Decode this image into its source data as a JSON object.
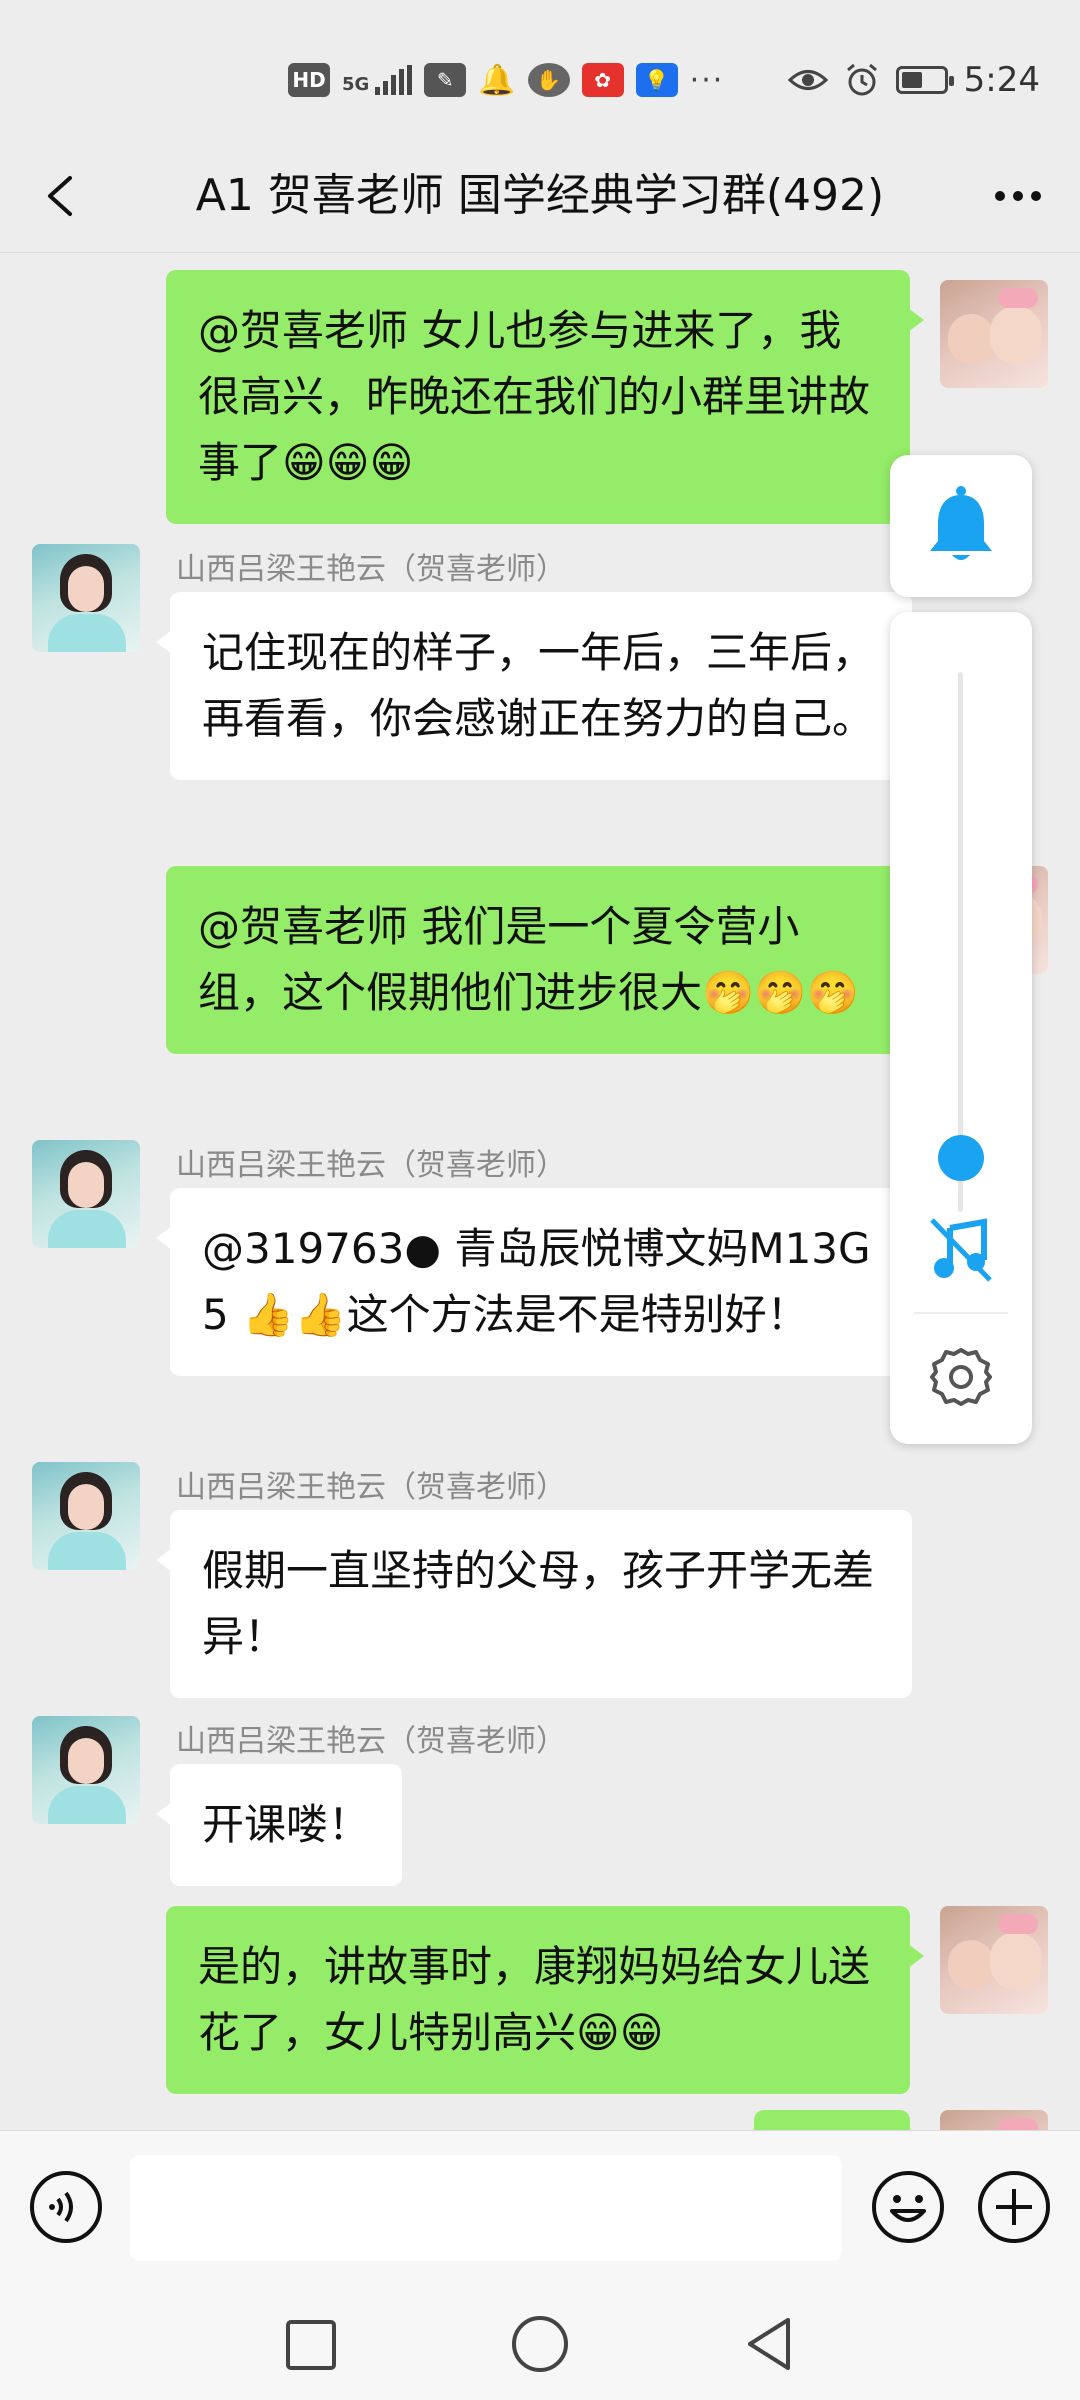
{
  "status_bar": {
    "network_icons": [
      "HD",
      "5G"
    ],
    "time": "5:24"
  },
  "header": {
    "title": "A1 贺喜老师 国学经典学习群(492)"
  },
  "messages": [
    {
      "side": "right",
      "color": "green",
      "text": "@贺喜老师  女儿也参与进来了，我很高兴，昨晚还在我们的小群里讲故事了😁😁😁"
    },
    {
      "side": "left",
      "sender": "山西吕梁王艳云（贺喜老师）",
      "text": "记住现在的样子，一年后，三年后，再看看，你会感谢正在努力的自己。"
    },
    {
      "side": "right",
      "color": "green",
      "text": "@贺喜老师  我们是一个夏令营小组，这个假期他们进步很大🤭🤭🤭"
    },
    {
      "side": "left",
      "sender": "山西吕梁王艳云（贺喜老师）",
      "text": "@319763● 青岛辰悦博文妈M13G5 👍👍这个方法是不是特别好！"
    },
    {
      "side": "left",
      "sender": "山西吕梁王艳云（贺喜老师）",
      "text": "假期一直坚持的父母，孩子开学无差异！"
    },
    {
      "side": "left",
      "sender": "山西吕梁王艳云（贺喜老师）",
      "text": "开课喽！"
    },
    {
      "side": "right",
      "color": "green",
      "text": "是的，讲故事时，康翔妈妈给女儿送花了，女儿特别高兴😁😁"
    }
  ],
  "float_panel": {
    "level_fraction": 0.1,
    "accent_color": "#1aa3f0",
    "icons": [
      "bell-icon",
      "music-off-icon",
      "gear-icon"
    ]
  },
  "input": {
    "value": "",
    "placeholder": ""
  },
  "colors": {
    "sent_bubble": "#95ec69",
    "received_bubble": "#ffffff",
    "background": "#ededed"
  }
}
